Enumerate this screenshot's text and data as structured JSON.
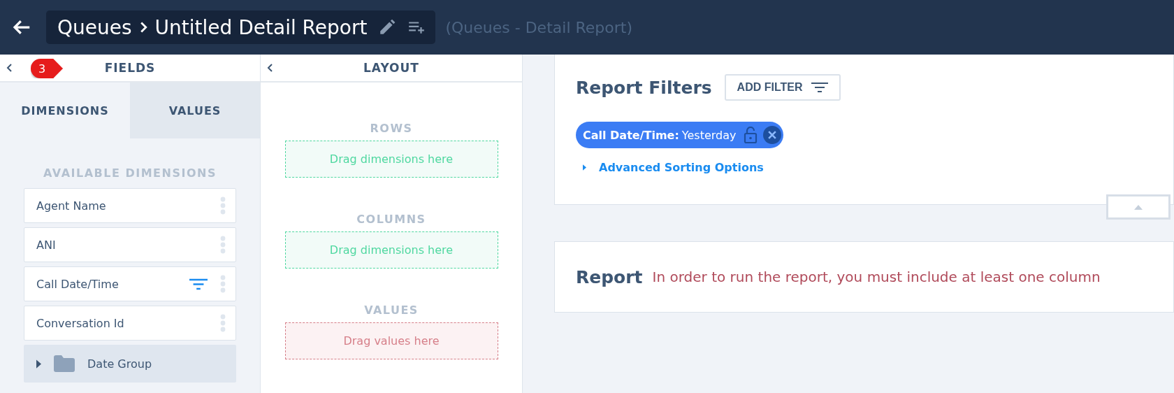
{
  "header": {
    "breadcrumb": [
      "Queues",
      "Untitled Detail Report"
    ],
    "subtitle": "(Queues - Detail Report)"
  },
  "fields_panel": {
    "title": "FIELDS",
    "badge": "3",
    "tabs": [
      {
        "label": "DIMENSIONS",
        "selected": true
      },
      {
        "label": "VALUES",
        "selected": false
      }
    ],
    "section_label": "AVAILABLE DIMENSIONS",
    "items": [
      {
        "kind": "field",
        "label": "Agent Name",
        "filtered": false
      },
      {
        "kind": "field",
        "label": "ANI",
        "filtered": false
      },
      {
        "kind": "field",
        "label": "Call Date/Time",
        "filtered": true
      },
      {
        "kind": "field",
        "label": "Conversation Id",
        "filtered": false
      },
      {
        "kind": "group",
        "label": "Date Group"
      }
    ]
  },
  "layout_panel": {
    "title": "LAYOUT",
    "zones": [
      {
        "kind": "dimension",
        "label": "ROWS",
        "hint": "Drag dimensions here"
      },
      {
        "kind": "dimension",
        "label": "COLUMNS",
        "hint": "Drag dimensions here"
      },
      {
        "kind": "value",
        "label": "VALUES",
        "hint": "Drag values here"
      }
    ]
  },
  "filters_card": {
    "title": "Report Filters",
    "add_button": "ADD FILTER",
    "chips": [
      {
        "name": "Call Date/Time:",
        "value": "Yesterday"
      }
    ],
    "advanced_link": "Advanced Sorting Options"
  },
  "report_card": {
    "title": "Report",
    "message": "In order to run the report, you must include at least one column"
  }
}
